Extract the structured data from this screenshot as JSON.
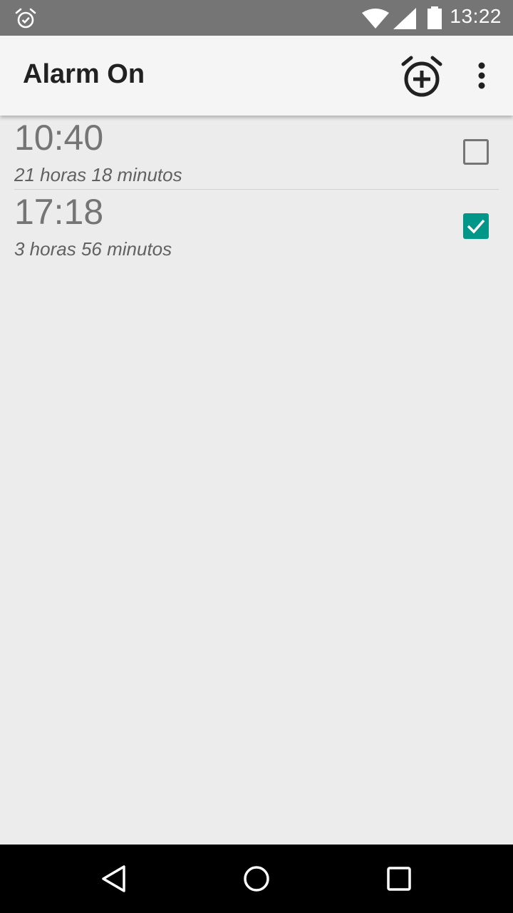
{
  "status_bar": {
    "time": "13:22",
    "icons": [
      "alarm-icon",
      "wifi-icon",
      "signal-icon",
      "battery-icon"
    ]
  },
  "app_bar": {
    "title": "Alarm On",
    "actions": [
      "add-alarm-icon",
      "overflow-menu-icon"
    ]
  },
  "alarms": [
    {
      "time": "10:40",
      "remaining": "21 horas 18 minutos",
      "enabled": false
    },
    {
      "time": "17:18",
      "remaining": "3 horas 56 minutos",
      "enabled": true
    }
  ],
  "nav_bar": {
    "icons": [
      "back-icon",
      "home-icon",
      "recents-icon"
    ]
  },
  "colors": {
    "accent": "#009688",
    "status_bar": "#757575",
    "app_bar": "#f5f5f5",
    "background": "#ececec"
  }
}
